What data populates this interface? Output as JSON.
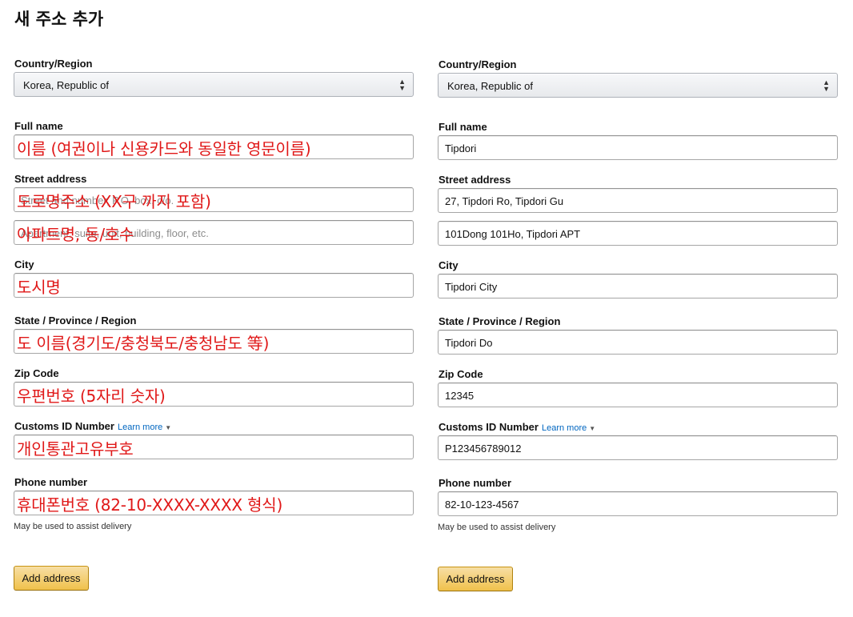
{
  "page_title": "새 주소 추가",
  "left_form": {
    "country_label": "Country/Region",
    "country_value": "Korea, Republic of",
    "full_name_label": "Full name",
    "full_name_overlay": "이름 (여권이나 신용카드와 동일한 영문이름)",
    "street_label": "Street address",
    "street1_placeholder": "Street and number, P.O. box, c/o.",
    "street1_overlay": "도로명주소 (XX구 까지 포함)",
    "street2_placeholder": "Apartment, suite, unit, building, floor, etc.",
    "street2_overlay": "아파트명, 동/호수",
    "city_label": "City",
    "city_overlay": "도시명",
    "state_label": "State / Province / Region",
    "state_overlay": "도 이름(경기도/충청북도/충청남도 等)",
    "zip_label": "Zip Code",
    "zip_overlay": "우편번호 (5자리 숫자)",
    "customs_label": "Customs ID Number",
    "learn_more": "Learn more",
    "customs_overlay": "개인통관고유부호",
    "phone_label": "Phone number",
    "phone_overlay": "휴대폰번호 (82-10-XXXX-XXXX 형식)",
    "phone_hint": "May be used to assist delivery",
    "add_button": "Add address"
  },
  "right_form": {
    "country_label": "Country/Region",
    "country_value": "Korea, Republic of",
    "full_name_label": "Full name",
    "full_name_value": "Tipdori",
    "street_label": "Street address",
    "street1_value": "27, Tipdori Ro, Tipdori Gu",
    "street2_value": "101Dong 101Ho, Tipdori APT",
    "city_label": "City",
    "city_value": "Tipdori City",
    "state_label": "State / Province / Region",
    "state_value": "Tipdori Do",
    "zip_label": "Zip Code",
    "zip_value": "12345",
    "customs_label": "Customs ID Number",
    "learn_more": "Learn more",
    "customs_value": "P123456789012",
    "phone_label": "Phone number",
    "phone_value": "82-10-123-4567",
    "phone_hint": "May be used to assist delivery",
    "add_button": "Add address"
  },
  "colors": {
    "annotation_red": "#e01818",
    "link_blue": "#0066c0",
    "button_yellow": "#f0c14b"
  }
}
